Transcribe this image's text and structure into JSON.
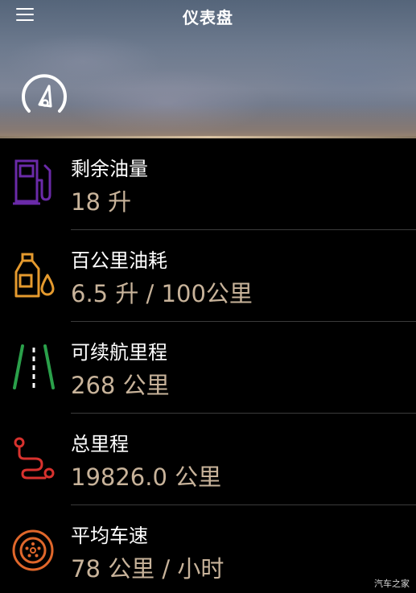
{
  "header": {
    "title": "仪表盘",
    "menu_icon": "hamburger-menu-icon",
    "gauge_icon": "speedometer-icon"
  },
  "items": [
    {
      "label": "剩余油量",
      "value": "18 升",
      "icon": "fuel-pump-icon",
      "icon_color": "#6a2aa8"
    },
    {
      "label": "百公里油耗",
      "value": "6.5 升 / 100公里",
      "icon": "oil-canister-icon",
      "icon_color": "#e59a2e"
    },
    {
      "label": "可续航里程",
      "value": "268 公里",
      "icon": "road-lanes-icon",
      "icon_color": "#2aa04a"
    },
    {
      "label": "总里程",
      "value": "19826.0 公里",
      "icon": "route-path-icon",
      "icon_color": "#d8322e"
    },
    {
      "label": "平均车速",
      "value": "78 公里 / 小时",
      "icon": "wheel-icon",
      "icon_color": "#e0672b"
    }
  ],
  "watermark": "汽车之家",
  "colors": {
    "background": "#000000",
    "label": "#ffffff",
    "value": "#c8b39a",
    "divider": "#3b3b3b"
  }
}
